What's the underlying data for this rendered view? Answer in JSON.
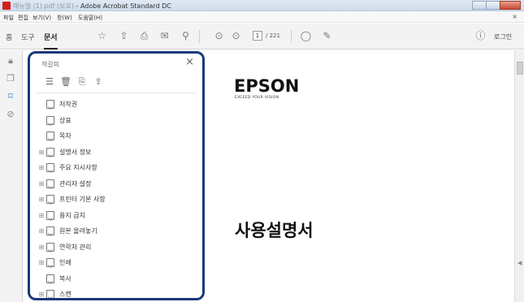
{
  "window": {
    "title_blurred": "매뉴얼 (1).pdf (보호)",
    "title": "- Adobe Acrobat Standard DC"
  },
  "menu": [
    "파일",
    "편집",
    "보기(V)",
    "창(W)",
    "도움말(H)"
  ],
  "toolbar": {
    "home": "홈",
    "tools": "도구",
    "document": "문서",
    "page_current": "1",
    "page_total": "/ 221",
    "login": "로그인"
  },
  "panel": {
    "title": "책갈피",
    "bookmarks": [
      {
        "label": "저작권",
        "expandable": false
      },
      {
        "label": "상표",
        "expandable": false
      },
      {
        "label": "목차",
        "expandable": false
      },
      {
        "label": "설명서 정보",
        "expandable": true
      },
      {
        "label": "주요 지시사항",
        "expandable": true
      },
      {
        "label": "관리자 설정",
        "expandable": true
      },
      {
        "label": "프린터 기본 사항",
        "expandable": true
      },
      {
        "label": "용지 급지",
        "expandable": true
      },
      {
        "label": "원본 올려놓기",
        "expandable": true
      },
      {
        "label": "연락처 관리",
        "expandable": true
      },
      {
        "label": "인쇄",
        "expandable": true
      },
      {
        "label": "복사",
        "expandable": false
      },
      {
        "label": "스캔",
        "expandable": true
      }
    ]
  },
  "document": {
    "logo": "EPSON",
    "tagline": "EXCEED YOUR VISION",
    "heading": "사용설명서"
  }
}
